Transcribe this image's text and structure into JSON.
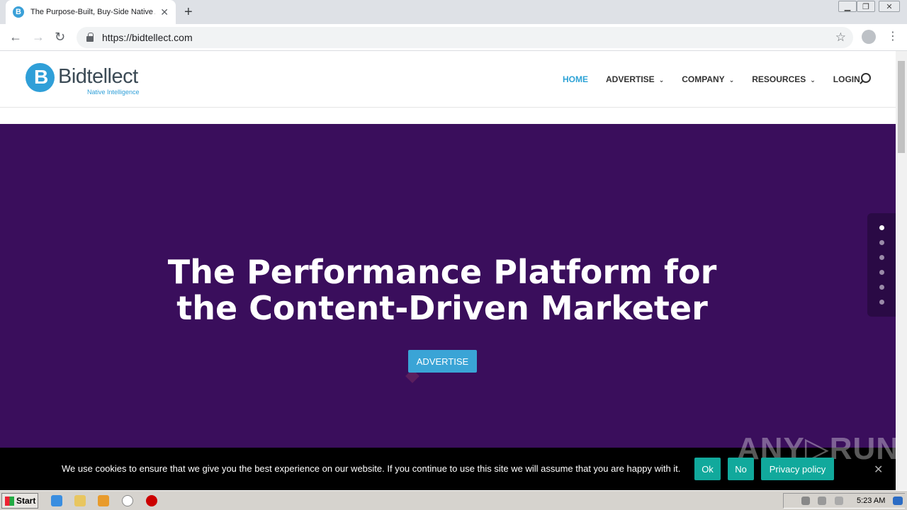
{
  "browser": {
    "tab_title": "The Purpose-Built, Buy-Side Native A",
    "url": "https://bidtellect.com",
    "colors": {
      "favicon": "#3aa0d8"
    }
  },
  "site": {
    "logo_name": "Bidtellect",
    "logo_tagline": "Native Intelligence",
    "nav": [
      {
        "label": "HOME",
        "dropdown": false,
        "active": true
      },
      {
        "label": "ADVERTISE",
        "dropdown": true,
        "active": false
      },
      {
        "label": "COMPANY",
        "dropdown": true,
        "active": false
      },
      {
        "label": "RESOURCES",
        "dropdown": true,
        "active": false
      },
      {
        "label": "LOGIN",
        "dropdown": false,
        "active": false
      }
    ],
    "hero": {
      "title_line1": "The Performance Platform for",
      "title_line2": "the Content-Driven Marketer",
      "button_label": "ADVERTISE",
      "background_color": "#3a0e5c"
    },
    "slide_dots": {
      "count": 6,
      "active_index": 0
    },
    "cookie": {
      "message": "We use cookies to ensure that we give you the best experience on our website. If you continue to use this site we will assume that you are happy with it.",
      "ok_label": "Ok",
      "no_label": "No",
      "privacy_label": "Privacy policy",
      "close_glyph": "✕"
    },
    "watermark": "ANY RUN"
  },
  "taskbar": {
    "start_label": "Start",
    "clock": "5:23 AM"
  }
}
